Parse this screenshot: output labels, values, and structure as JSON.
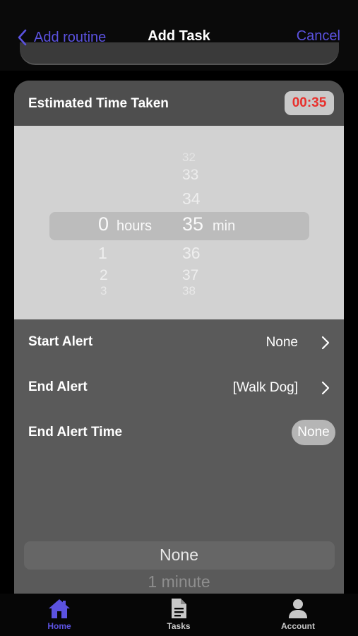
{
  "nav": {
    "back_label": "Add routine",
    "title": "Add Task",
    "cancel_label": "Cancel"
  },
  "estimated": {
    "label": "Estimated Time Taken",
    "value": "00:35"
  },
  "picker": {
    "hours_label": "hours",
    "min_label": "min",
    "hours_selected": "0",
    "hours_below": [
      "1",
      "2",
      "3"
    ],
    "minutes_above": [
      "32",
      "33",
      "34"
    ],
    "minutes_selected": "35",
    "minutes_below": [
      "36",
      "37",
      "38"
    ]
  },
  "rows": {
    "start_alert": {
      "label": "Start Alert",
      "value": "None"
    },
    "end_alert": {
      "label": "End Alert",
      "value": "[Walk Dog]"
    },
    "end_alert_time": {
      "label": "End Alert Time",
      "value": "None"
    }
  },
  "alert_picker": {
    "selected": "None",
    "next": "1 minute"
  },
  "tabs": [
    {
      "label": "Home",
      "icon": "home-icon",
      "active": true
    },
    {
      "label": "Tasks",
      "icon": "document-icon",
      "active": false
    },
    {
      "label": "Account",
      "icon": "person-icon",
      "active": false
    }
  ],
  "colors": {
    "accent": "#5b52e0",
    "badge_text": "#e8302c",
    "background": "#000000",
    "card": "#5a5a5a"
  }
}
